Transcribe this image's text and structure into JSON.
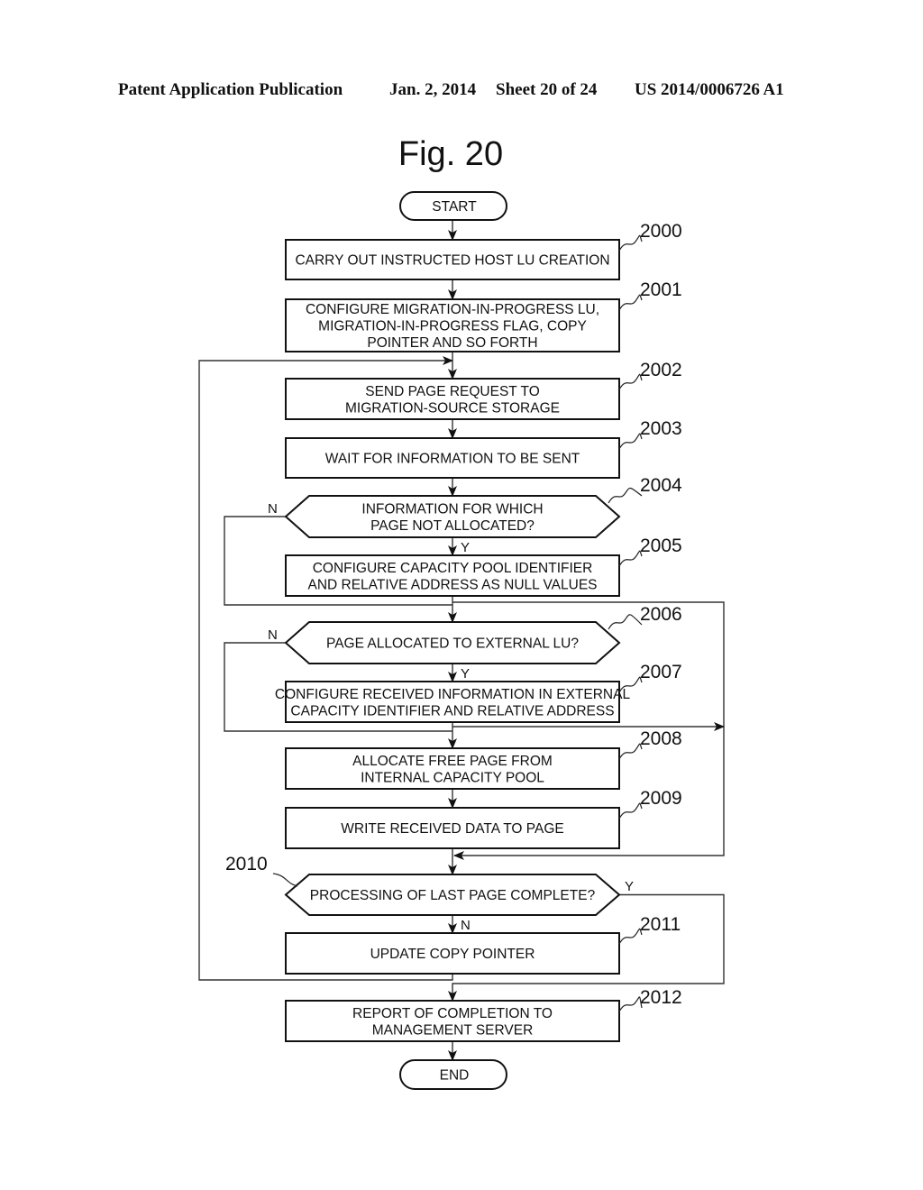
{
  "header": {
    "publication": "Patent Application Publication",
    "date": "Jan. 2, 2014",
    "sheet": "Sheet 20 of 24",
    "number": "US 2014/0006726 A1"
  },
  "figure": {
    "title": "Fig. 20"
  },
  "nodes": {
    "start": {
      "lines": [
        "START"
      ]
    },
    "n2000": {
      "ref": "2000",
      "lines": [
        "CARRY OUT INSTRUCTED HOST LU CREATION"
      ]
    },
    "n2001": {
      "ref": "2001",
      "lines": [
        "CONFIGURE MIGRATION-IN-PROGRESS LU,",
        "MIGRATION-IN-PROGRESS FLAG, COPY",
        "POINTER AND SO FORTH"
      ]
    },
    "n2002": {
      "ref": "2002",
      "lines": [
        "SEND PAGE REQUEST TO",
        "MIGRATION-SOURCE STORAGE"
      ]
    },
    "n2003": {
      "ref": "2003",
      "lines": [
        "WAIT FOR INFORMATION TO BE SENT"
      ]
    },
    "n2004": {
      "ref": "2004",
      "lines": [
        "INFORMATION FOR WHICH",
        "PAGE NOT ALLOCATED?"
      ],
      "yes": "Y",
      "no": "N"
    },
    "n2005": {
      "ref": "2005",
      "lines": [
        "CONFIGURE CAPACITY POOL IDENTIFIER",
        "AND RELATIVE ADDRESS AS NULL VALUES"
      ]
    },
    "n2006": {
      "ref": "2006",
      "lines": [
        "PAGE ALLOCATED TO EXTERNAL LU?"
      ],
      "yes": "Y",
      "no": "N"
    },
    "n2007": {
      "ref": "2007",
      "lines": [
        "CONFIGURE RECEIVED INFORMATION IN EXTERNAL",
        "CAPACITY IDENTIFIER AND RELATIVE ADDRESS"
      ]
    },
    "n2008": {
      "ref": "2008",
      "lines": [
        "ALLOCATE FREE PAGE FROM",
        "INTERNAL CAPACITY POOL"
      ]
    },
    "n2009": {
      "ref": "2009",
      "lines": [
        "WRITE RECEIVED DATA TO PAGE"
      ]
    },
    "n2010": {
      "ref": "2010",
      "lines": [
        "PROCESSING OF LAST PAGE COMPLETE?"
      ],
      "yes": "Y",
      "no": "N"
    },
    "n2011": {
      "ref": "2011",
      "lines": [
        "UPDATE COPY POINTER"
      ]
    },
    "n2012": {
      "ref": "2012",
      "lines": [
        "REPORT OF COMPLETION TO",
        "MANAGEMENT SERVER"
      ]
    },
    "end": {
      "lines": [
        "END"
      ]
    }
  }
}
